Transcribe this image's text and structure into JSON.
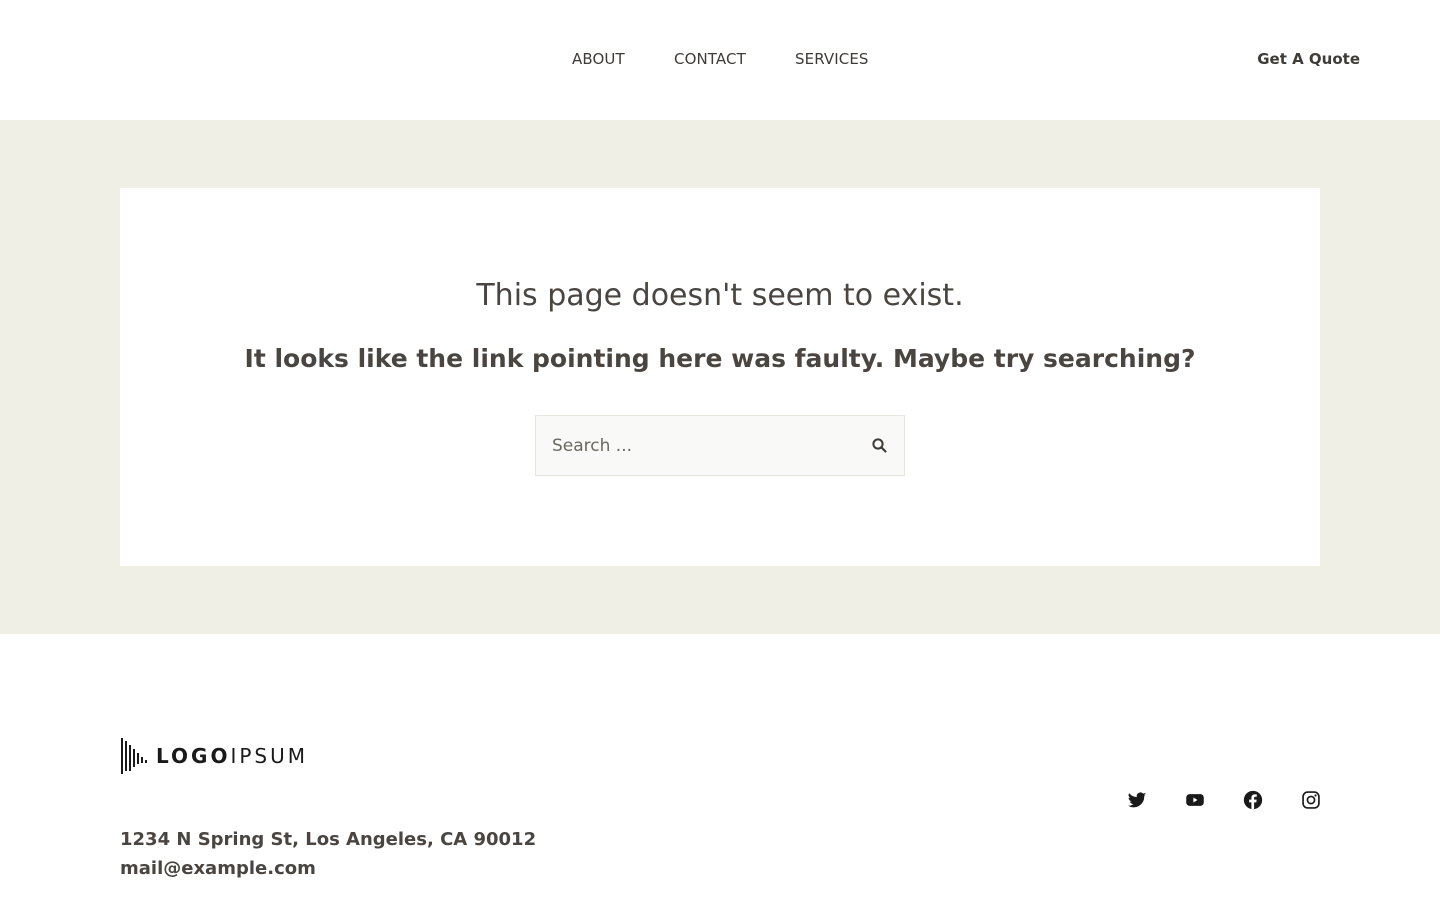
{
  "header": {
    "nav": [
      {
        "label": "ABOUT"
      },
      {
        "label": "CONTACT"
      },
      {
        "label": "SERVICES"
      }
    ],
    "cta_label": "Get A Quote"
  },
  "main": {
    "title": "This page doesn't seem to exist.",
    "subtitle": "It looks like the link pointing here was faulty. Maybe try searching?",
    "search": {
      "placeholder": "Search ...",
      "value": ""
    }
  },
  "footer": {
    "logo": {
      "bold_text": "LOGO",
      "light_text": "IPSUM"
    },
    "address": "1234 N Spring St, Los Angeles, CA 90012",
    "email": "mail@example.com",
    "social": [
      "twitter-icon",
      "youtube-icon",
      "facebook-icon",
      "instagram-icon"
    ]
  },
  "colors": {
    "band_background": "#f0efe6",
    "text": "#4a4540"
  }
}
